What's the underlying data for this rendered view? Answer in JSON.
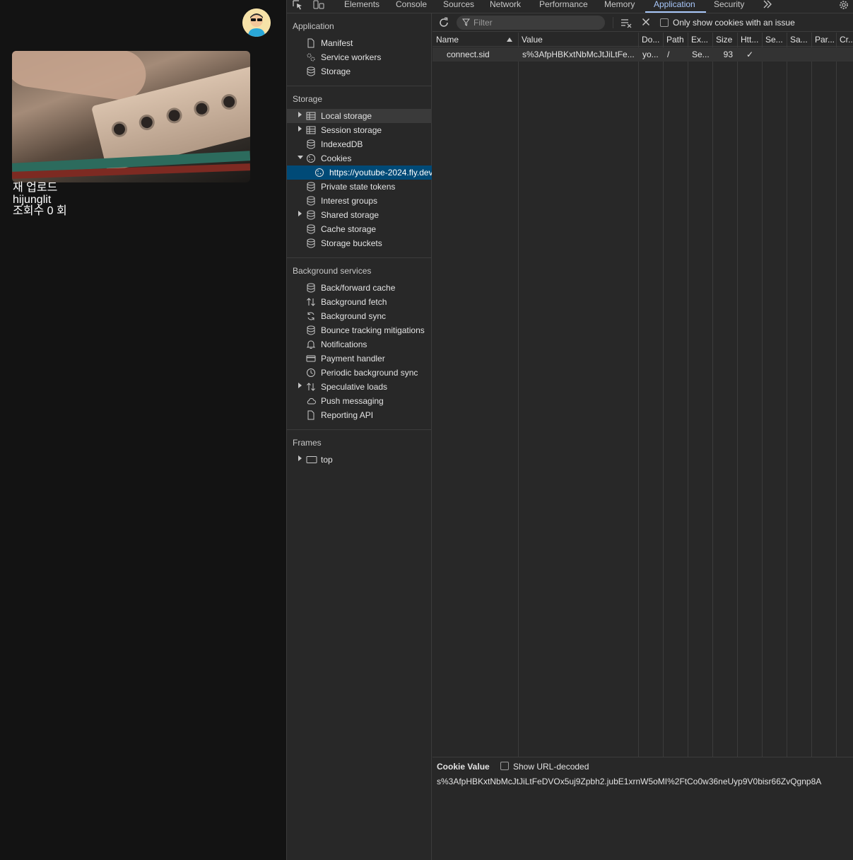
{
  "page": {
    "video": {
      "title": "재 업로드",
      "channel": "hijunglit",
      "views": "조회수 0 회"
    }
  },
  "devtools": {
    "tabs": [
      {
        "label": "Elements"
      },
      {
        "label": "Console"
      },
      {
        "label": "Sources"
      },
      {
        "label": "Network"
      },
      {
        "label": "Performance"
      },
      {
        "label": "Memory"
      },
      {
        "label": "Application"
      },
      {
        "label": "Security"
      }
    ],
    "active_tab": "Application",
    "sidebar": {
      "application": {
        "title": "Application",
        "items": [
          "Manifest",
          "Service workers",
          "Storage"
        ]
      },
      "storage": {
        "title": "Storage",
        "items": [
          "Local storage",
          "Session storage",
          "IndexedDB",
          "Cookies",
          "https://youtube-2024.fly.dev",
          "Private state tokens",
          "Interest groups",
          "Shared storage",
          "Cache storage",
          "Storage buckets"
        ]
      },
      "background": {
        "title": "Background services",
        "items": [
          "Back/forward cache",
          "Background fetch",
          "Background sync",
          "Bounce tracking mitigations",
          "Notifications",
          "Payment handler",
          "Periodic background sync",
          "Speculative loads",
          "Push messaging",
          "Reporting API"
        ]
      },
      "frames": {
        "title": "Frames",
        "items": [
          "top"
        ]
      }
    },
    "toolbar": {
      "filter_placeholder": "Filter",
      "issue_checkbox_label": "Only show cookies with an issue"
    },
    "cookies_table": {
      "columns": [
        "Name",
        "Value",
        "Do...",
        "Path",
        "Ex...",
        "Size",
        "Htt...",
        "Se...",
        "Sa...",
        "Par...",
        "Cr..."
      ],
      "rows": [
        {
          "name": "connect.sid",
          "value": "s%3AfpHBKxtNbMcJtJiLtFe...",
          "domain": "yo...",
          "path": "/",
          "expires": "Se...",
          "size": "93",
          "httponly": "✓",
          "secure": "",
          "samesite": "",
          "partition": "",
          "cross_site": ""
        }
      ]
    },
    "cookie_value": {
      "title": "Cookie Value",
      "decode_label": "Show URL-decoded",
      "value": "s%3AfpHBKxtNbMcJtJiLtFeDVOx5uj9Zpbh2.jubE1xrnW5oMI%2FtCo0w36neUyp9V0bisr66ZvQgnp8A"
    }
  },
  "colors": {
    "accent": "#a8c7fa",
    "selected_bg": "#004a77",
    "panel_bg": "#282828",
    "page_bg": "#131313"
  }
}
